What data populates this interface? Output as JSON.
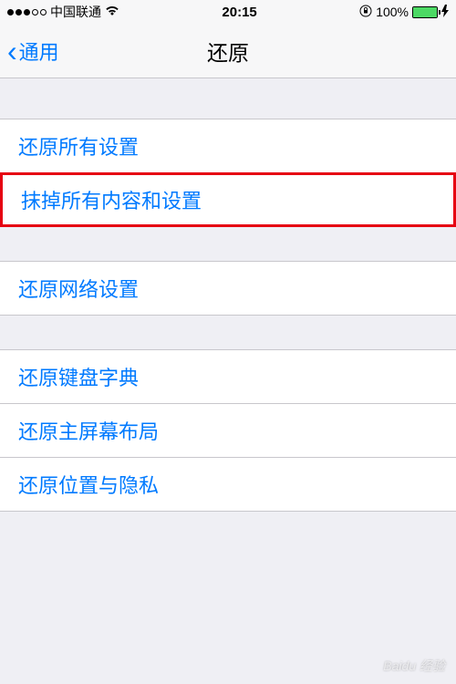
{
  "status": {
    "carrier": "中国联通",
    "time": "20:15",
    "battery_percent": "100%"
  },
  "nav": {
    "back_label": "通用",
    "title": "还原"
  },
  "groups": [
    {
      "items": [
        {
          "label": "还原所有设置",
          "highlighted": false
        },
        {
          "label": "抹掉所有内容和设置",
          "highlighted": true
        }
      ]
    },
    {
      "items": [
        {
          "label": "还原网络设置",
          "highlighted": false
        }
      ]
    },
    {
      "items": [
        {
          "label": "还原键盘字典",
          "highlighted": false
        },
        {
          "label": "还原主屏幕布局",
          "highlighted": false
        },
        {
          "label": "还原位置与隐私",
          "highlighted": false
        }
      ]
    }
  ],
  "watermark": "Baidu 经验"
}
